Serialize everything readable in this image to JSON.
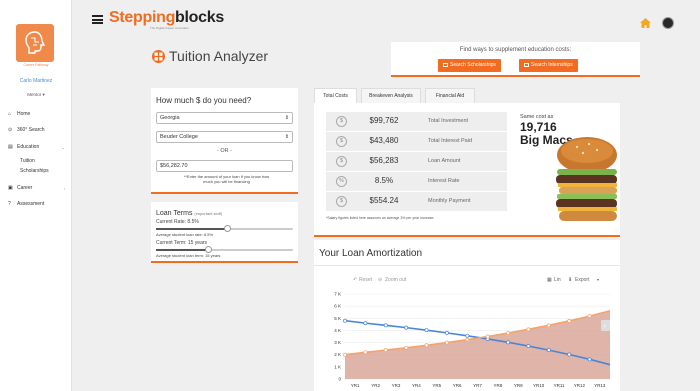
{
  "sidebar": {
    "logo_caption": "Career Pathway",
    "user_name": "Carlo Martinez",
    "user_role": "Mentor",
    "nav": [
      {
        "label": "Home",
        "icon": "home-icon"
      },
      {
        "label": "360° Search",
        "icon": "location-icon"
      },
      {
        "label": "Education",
        "icon": "book-icon"
      },
      {
        "label": "Career",
        "icon": "briefcase-icon"
      },
      {
        "label": "Assessment",
        "icon": "question-icon"
      }
    ],
    "education_sub": [
      "Tuition",
      "Scholarships"
    ]
  },
  "header": {
    "brand_part1": "Stepping",
    "brand_part2": "blocks",
    "tagline": "The Digital Career Counselor"
  },
  "page": {
    "title": "Tuition Analyzer"
  },
  "supplement": {
    "text": "Find ways to supplement education costs:",
    "scholarships_btn": "Search Scholarships",
    "internships_btn": "Search Internships"
  },
  "loan_form": {
    "heading": "How much $ do you need?",
    "state": "Georgia",
    "college": "Beuder College",
    "or_text": "- OR -",
    "amount": "$56,282.70",
    "note": "**Enter the amount of your loan if you know how much you will be financing"
  },
  "loan_terms": {
    "heading": "Loan Terms",
    "heading_note": "(important stuff)",
    "rate_label": "Current Rate: 8.5%",
    "rate_avg": "Average student loan rate: 6.5%",
    "term_label": "Current Term: 15 years",
    "term_avg": "Average student loan term: 15 years",
    "rate_level": 0.52,
    "term_level": 0.38
  },
  "tabs": [
    "Total Costs",
    "Breakeven Analysis",
    "Financial Aid"
  ],
  "results": {
    "rows": [
      {
        "value": "$99,762",
        "label": "Total Investment",
        "icon": "$"
      },
      {
        "value": "$43,480",
        "label": "Total Interest Paid",
        "icon": "$"
      },
      {
        "value": "$56,283",
        "label": "Loan Amount",
        "icon": "$"
      },
      {
        "value": "8.5%",
        "label": "Interest Rate",
        "icon": "%"
      },
      {
        "value": "$554.24",
        "label": "Monthly Payment",
        "icon": "$"
      }
    ],
    "footnote": "*Salary figures listed here assumes an average 3% per year increase.",
    "same_cost_label": "Same cost as",
    "same_cost_value": "19,716",
    "same_cost_item": "Big Macs"
  },
  "amortization": {
    "title": "Your Loan Amortization",
    "reset": "Reset",
    "zoom_out": "Zoom out",
    "lin": "Lin",
    "export": "Export"
  },
  "chart_data": {
    "type": "line",
    "x": [
      "YR1",
      "YR2",
      "YR3",
      "YR4",
      "YR5",
      "YR6",
      "YR7",
      "YR8",
      "YR9",
      "YR10",
      "YR11",
      "YR12",
      "YR13"
    ],
    "yticks": [
      "0",
      "1 K",
      "2 K",
      "3 K",
      "4 K",
      "5 K",
      "6 K",
      "7 K"
    ],
    "ylim": [
      0,
      7000
    ],
    "series": [
      {
        "name": "principal",
        "color": "#4a86d8",
        "values": [
          4800,
          4600,
          4420,
          4230,
          4020,
          3800,
          3560,
          3300,
          3020,
          2710,
          2380,
          2020,
          1620,
          1180
        ]
      },
      {
        "name": "interest",
        "color": "#f4a36b",
        "values": [
          2000,
          2200,
          2380,
          2570,
          2780,
          3000,
          3240,
          3500,
          3780,
          4090,
          4420,
          4780,
          5180,
          5620
        ]
      }
    ]
  }
}
